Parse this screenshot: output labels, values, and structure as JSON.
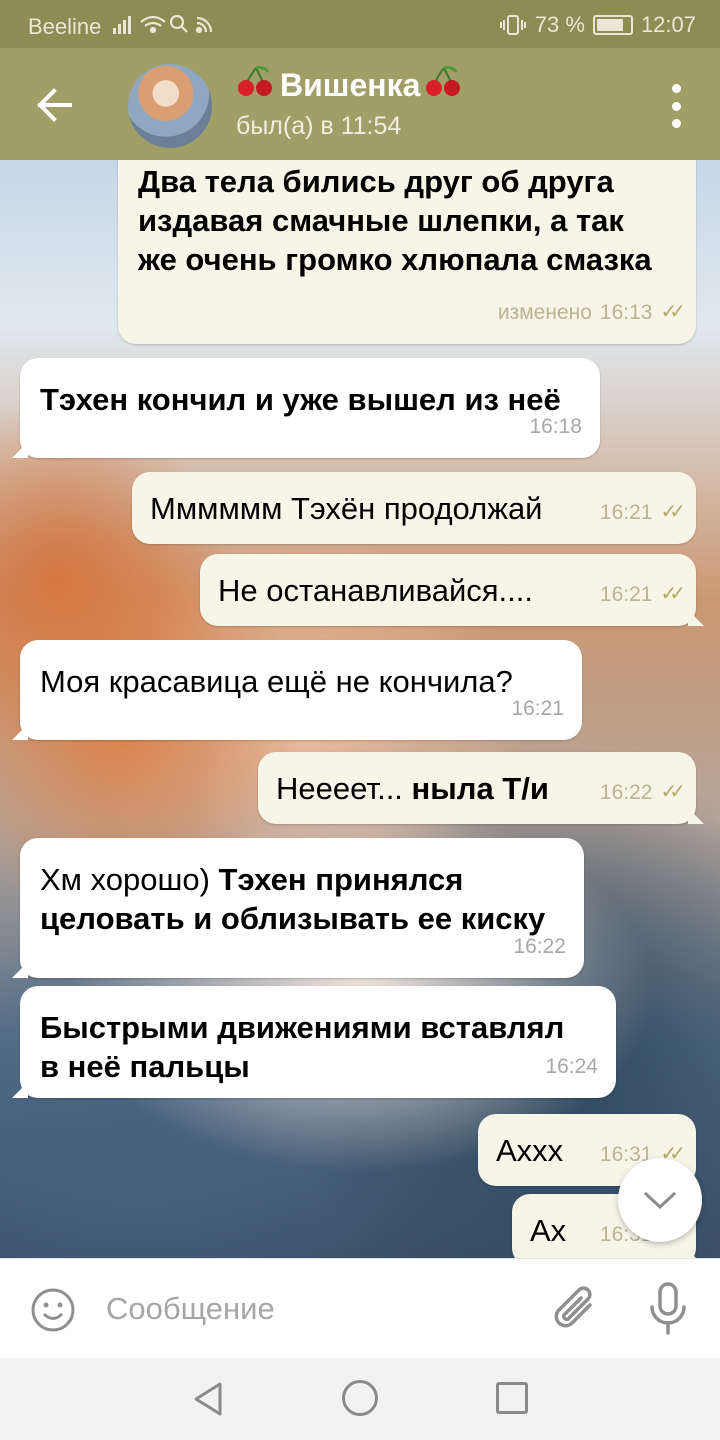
{
  "status_bar": {
    "carrier": "Beeline",
    "battery": "73 %",
    "time": "12:07"
  },
  "header": {
    "contact_name": "Вишенка",
    "last_seen": "был(а) в 11:54",
    "left_emoji": "cherry-emoji",
    "right_emoji": "cherry-emoji"
  },
  "messages": [
    {
      "direction": "out",
      "lines": [
        "Два тела бились друг об друга",
        "издавая смачные шлепки, а так",
        "же очень громко хлюпала смазка"
      ],
      "edited_label": "изменено",
      "time": "16:13",
      "read": true
    },
    {
      "direction": "in",
      "text": "Тэхен кончил и уже вышел из неё",
      "time": "16:18"
    },
    {
      "direction": "out",
      "text": "Мммммм Тэхён продолжай",
      "time": "16:21",
      "read": true
    },
    {
      "direction": "out",
      "text": "Не останавливайся....",
      "time": "16:21",
      "read": true
    },
    {
      "direction": "in",
      "text": "Моя красавица ещё не кончила?",
      "time": "16:21"
    },
    {
      "direction": "out",
      "text_plain": "Неееет... ",
      "text_bold": "ныла Т/и",
      "time": "16:22",
      "read": true
    },
    {
      "direction": "in",
      "text_plain": "Хм хорошо) ",
      "text_bold_1": "Тэхен принялся",
      "text_bold_2": "целовать и облизывать ее киску",
      "time": "16:22"
    },
    {
      "direction": "in",
      "lines": [
        "Быстрыми движениями вставлял",
        "в неё пальцы"
      ],
      "time": "16:24"
    },
    {
      "direction": "out",
      "text": "Аххх",
      "time": "16:31",
      "read": true
    },
    {
      "direction": "out",
      "text": "Ах",
      "time": "16:31",
      "read": true
    }
  ],
  "composer": {
    "placeholder": "Сообщение"
  },
  "colors": {
    "header_bg": "#a19e68",
    "status_bg": "#8f8b55",
    "out_bubble": "#f7f5e8",
    "in_bubble": "#ffffff",
    "tick_color": "#b2ab66"
  }
}
